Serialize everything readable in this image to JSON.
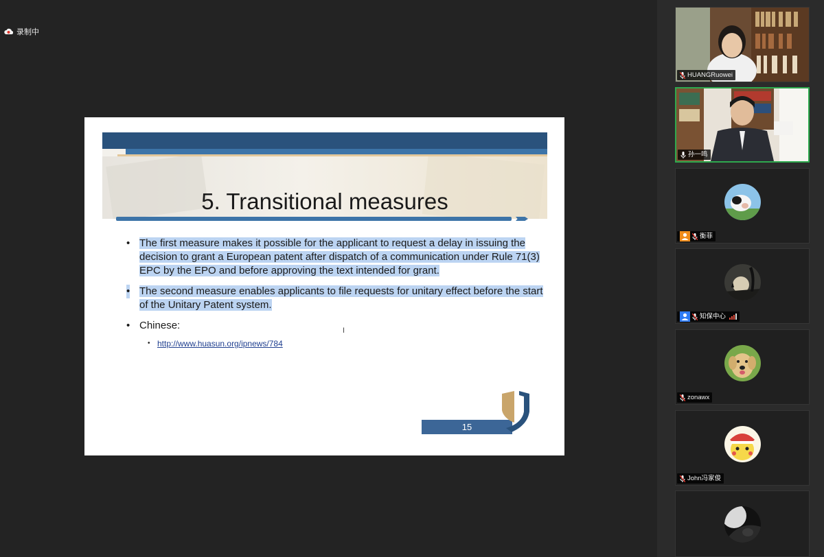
{
  "recording": {
    "label": "录制中"
  },
  "slide": {
    "title": "5. Transitional measures",
    "bullets": [
      {
        "text": "The first measure makes it possible for the applicant to request a delay in issuing the decision to grant a European patent after dispatch of a communication under Rule 71(3) EPC by the EPO and before approving the text intended for grant.",
        "highlighted": true
      },
      {
        "text": "The second measure enables applicants to file requests for unitary effect before the start of the Unitary Patent system.",
        "highlighted": true
      },
      {
        "text": "Chinese:",
        "highlighted": false
      }
    ],
    "sub_link": "http://www.huasun.org/ipnews/784",
    "page_number": "15",
    "bullet_glyph": "•"
  },
  "participants": [
    {
      "name": "HUANGRuowei",
      "type": "video",
      "muted": true
    },
    {
      "name": "孙一鸣",
      "type": "video",
      "muted": false,
      "active_speaker": true
    },
    {
      "name": "衡菲",
      "type": "avatar",
      "avatar": "cow",
      "muted": true,
      "badge_color": "#f08c1a"
    },
    {
      "name": "知保中心",
      "type": "avatar",
      "avatar": "sunset",
      "muted": true,
      "badge_color": "#2f7cf6",
      "signal": "weak"
    },
    {
      "name": "zonawx",
      "type": "avatar",
      "avatar": "dog",
      "muted": true
    },
    {
      "name": "John冯家俊",
      "type": "avatar",
      "avatar": "pikachu",
      "muted": true
    },
    {
      "name": "",
      "type": "avatar",
      "avatar": "dark",
      "muted": true
    }
  ],
  "colors": {
    "accent_active": "#2eaa4e",
    "slide_blue": "#2a527c",
    "highlight": "#bcd4f2"
  }
}
